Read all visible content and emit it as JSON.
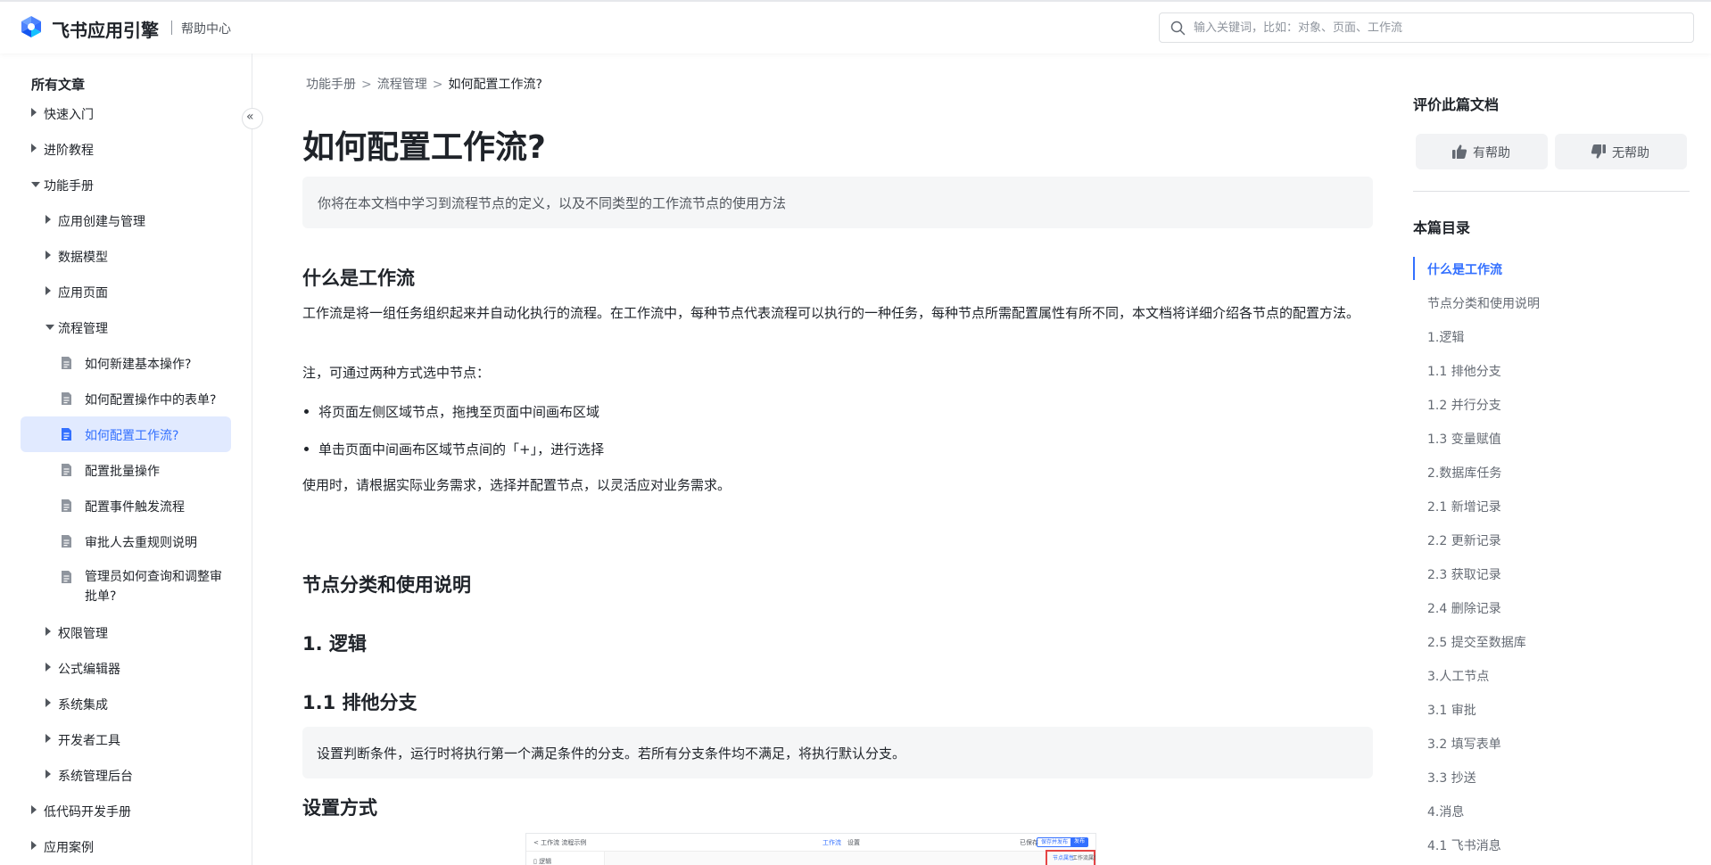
{
  "header": {
    "brand": "飞书应用引擎",
    "sub": "帮助中心",
    "search_placeholder": "输入关键词，比如：对象、页面、工作流"
  },
  "sidebar": {
    "title": "所有文章",
    "items": [
      {
        "label": "快速入门",
        "level": 0,
        "type": "collapsed"
      },
      {
        "label": "进阶教程",
        "level": 0,
        "type": "collapsed"
      },
      {
        "label": "功能手册",
        "level": 0,
        "type": "expanded"
      },
      {
        "label": "应用创建与管理",
        "level": 1,
        "type": "collapsed"
      },
      {
        "label": "数据模型",
        "level": 1,
        "type": "collapsed"
      },
      {
        "label": "应用页面",
        "level": 1,
        "type": "collapsed"
      },
      {
        "label": "流程管理",
        "level": 1,
        "type": "expanded"
      },
      {
        "label": "如何新建基本操作?",
        "level": 2,
        "type": "doc"
      },
      {
        "label": "如何配置操作中的表单?",
        "level": 2,
        "type": "doc"
      },
      {
        "label": "如何配置工作流?",
        "level": 2,
        "type": "doc",
        "active": true
      },
      {
        "label": "配置批量操作",
        "level": 2,
        "type": "doc"
      },
      {
        "label": "配置事件触发流程",
        "level": 2,
        "type": "doc"
      },
      {
        "label": "审批人去重规则说明",
        "level": 2,
        "type": "doc"
      },
      {
        "label": "管理员如何查询和调整审批单?",
        "level": 2,
        "type": "doc"
      },
      {
        "label": "权限管理",
        "level": 1,
        "type": "collapsed"
      },
      {
        "label": "公式编辑器",
        "level": 1,
        "type": "collapsed"
      },
      {
        "label": "系统集成",
        "level": 1,
        "type": "collapsed"
      },
      {
        "label": "开发者工具",
        "level": 1,
        "type": "collapsed"
      },
      {
        "label": "系统管理后台",
        "level": 1,
        "type": "collapsed"
      },
      {
        "label": "低代码开发手册",
        "level": 0,
        "type": "collapsed"
      },
      {
        "label": "应用案例",
        "level": 0,
        "type": "collapsed"
      }
    ]
  },
  "collapse_glyph": "«",
  "main": {
    "breadcrumb": [
      "功能手册",
      "流程管理",
      "如何配置工作流?"
    ],
    "breadcrumb_sep": ">",
    "title": "如何配置工作流?",
    "summary": "你将在本文档中学习到流程节点的定义，以及不同类型的工作流节点的使用方法",
    "h_what": "什么是工作流",
    "p_def": "工作流是将一组任务组织起来并自动化执行的流程。在工作流中，每种节点代表流程可以执行的一种任务，每种节点所需配置属性有所不同，本文档将详细介绍各节点的配置方法。",
    "p_note": "注，可通过两种方式选中节点：",
    "bullets": [
      "将页面左侧区域节点，拖拽至页面中间画布区域",
      "单击页面中间画布区域节点间的「+」，进行选择"
    ],
    "p_use": "使用时，请根据实际业务需求，选择并配置节点，以灵活应对业务需求。",
    "h_nodes": "节点分类和使用说明",
    "h_logic": "1.  逻辑",
    "h_branch": "1.1 排他分支",
    "callout": "设置判断条件，运行时将执行第一个满足条件的分支。若所有分支条件均不满足，将执行默认分支。",
    "h_setup": "设置方式",
    "screenshot": {
      "back": "< 工作流  流程示例",
      "tab1": "工作流",
      "tab2": "设置",
      "save_state": "已保存",
      "btn_outline": "保存并发布",
      "btn_primary": "发布",
      "left_item": "▯ 逻辑",
      "panel_tab1": "节点属性",
      "panel_tab2": "工作流属性"
    }
  },
  "right": {
    "feedback_title": "评价此篇文档",
    "helpful": "有帮助",
    "not_helpful": "无帮助",
    "toc_title": "本篇目录",
    "toc": [
      "什么是工作流",
      "节点分类和使用说明",
      "1.逻辑",
      "1.1 排他分支",
      "1.2 并行分支",
      "1.3 变量赋值",
      "2.数据库任务",
      "2.1 新增记录",
      "2.2 更新记录",
      "2.3 获取记录",
      "2.4 删除记录",
      "2.5 提交至数据库",
      "3.人工节点",
      "3.1 审批",
      "3.2 填写表单",
      "3.3 抄送",
      "4.消息",
      "4.1 飞书消息"
    ],
    "toc_active": 0
  },
  "colors": {
    "accent": "#3370ff",
    "active_bg": "#e1eaff",
    "text": "#1f2329",
    "muted": "#646a73",
    "callout_bg": "#f5f6f7",
    "highlight_red": "#e54545"
  }
}
